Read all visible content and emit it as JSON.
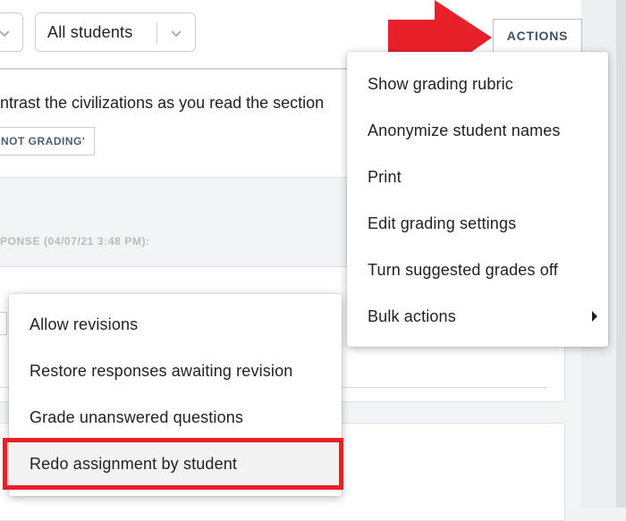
{
  "toolbar": {
    "filter_label": "All students",
    "actions_label": "ACTIONS"
  },
  "content": {
    "prompt_fragment": "ntrast the civilizations as you read the section",
    "tag_label": "NOT GRADING'",
    "response_label": "PONSE (04/07/21 3:48 PM):"
  },
  "actions_menu": {
    "items": [
      {
        "label": "Show grading rubric"
      },
      {
        "label": "Anonymize student names"
      },
      {
        "label": "Print"
      },
      {
        "label": "Edit grading settings"
      },
      {
        "label": "Turn suggested grades off"
      },
      {
        "label": "Bulk actions"
      }
    ]
  },
  "bulk_menu": {
    "items": [
      {
        "label": "Allow revisions"
      },
      {
        "label": "Restore responses awaiting revision"
      },
      {
        "label": "Grade unanswered questions"
      },
      {
        "label": "Redo assignment by student"
      }
    ]
  },
  "colors": {
    "annotation_red": "#e8202a",
    "actions_text": "#3e5167"
  }
}
